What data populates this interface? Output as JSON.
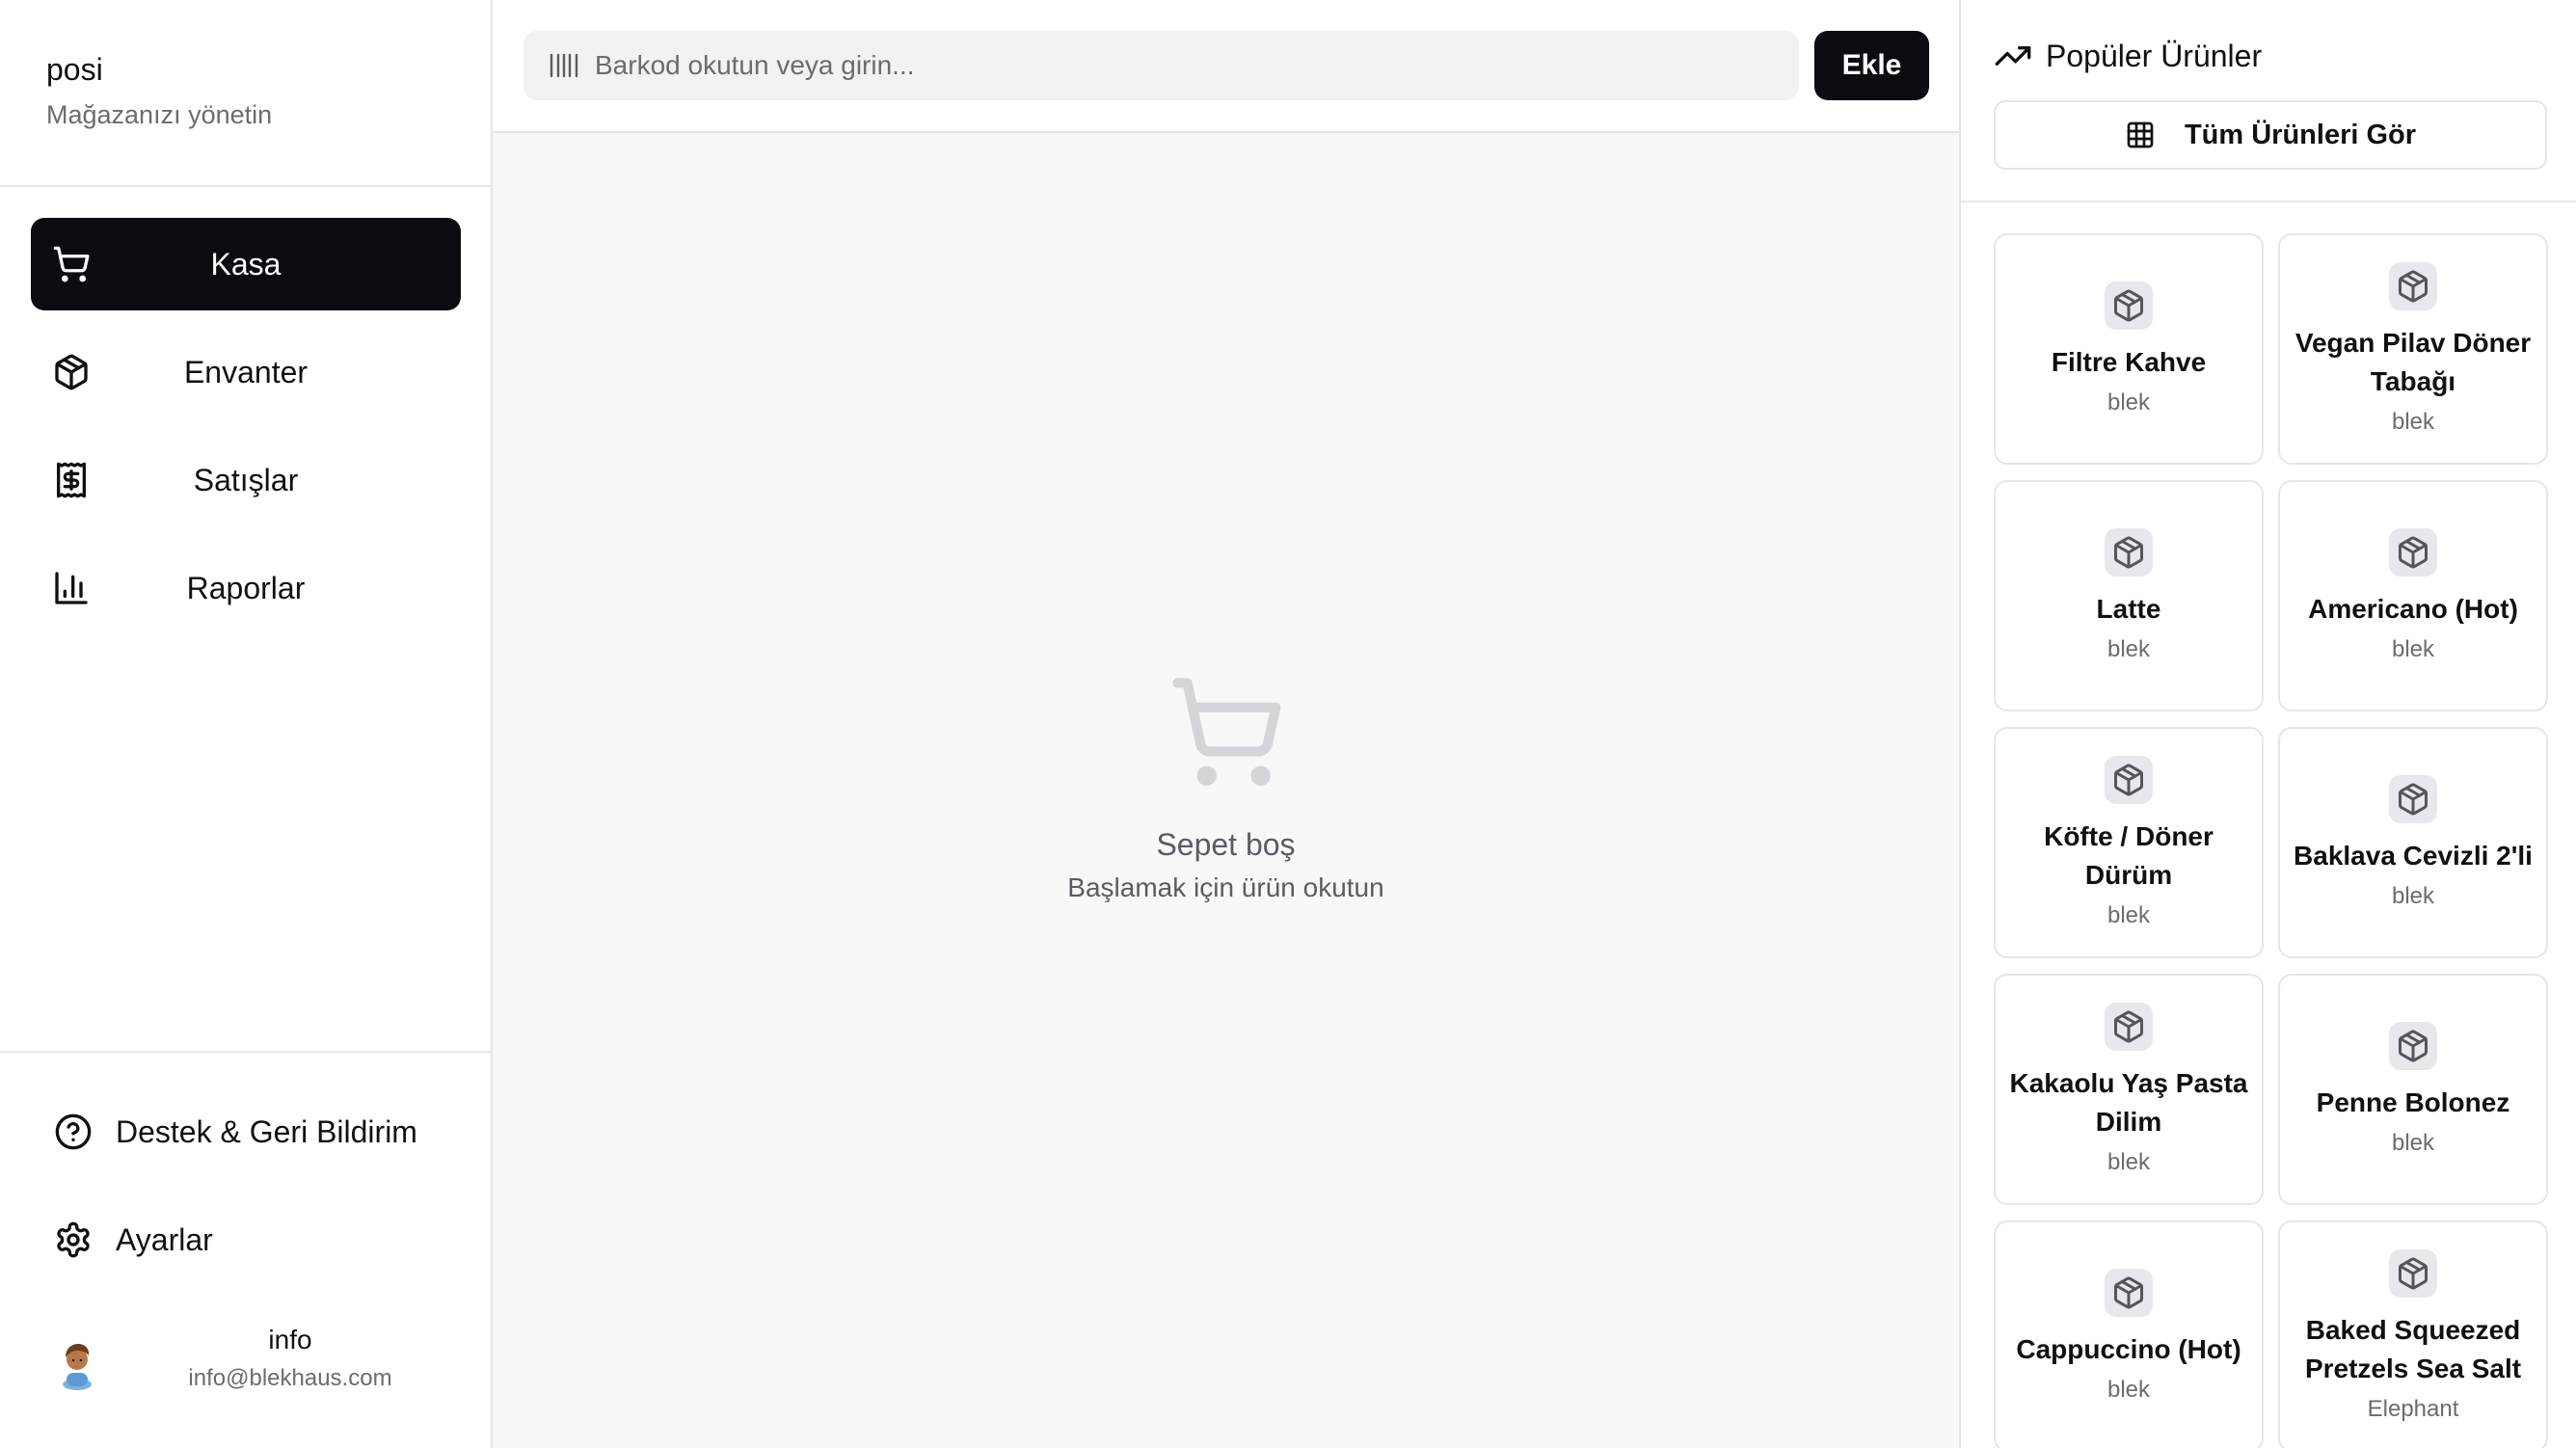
{
  "brand": {
    "name": "posi",
    "subtitle": "Mağazanızı yönetin"
  },
  "sidebar": {
    "items": [
      {
        "label": "Kasa",
        "icon": "cart-icon",
        "active": true
      },
      {
        "label": "Envanter",
        "icon": "package-icon",
        "active": false
      },
      {
        "label": "Satışlar",
        "icon": "receipt-dollar-icon",
        "active": false
      },
      {
        "label": "Raporlar",
        "icon": "bar-chart-icon",
        "active": false
      }
    ],
    "footer": [
      {
        "label": "Destek & Geri Bildirim",
        "icon": "help-circle-icon"
      },
      {
        "label": "Ayarlar",
        "icon": "gear-icon"
      }
    ],
    "user": {
      "name": "info",
      "email": "info@blekhaus.com"
    }
  },
  "topbar": {
    "search_placeholder": "Barkod okutun veya girin...",
    "search_value": "",
    "add_label": "Ekle"
  },
  "cart": {
    "empty_title": "Sepet boş",
    "empty_subtitle": "Başlamak için ürün okutun"
  },
  "popular": {
    "title": "Popüler Ürünler",
    "view_all_label": "Tüm Ürünleri Gör",
    "products": [
      {
        "name": "Filtre Kahve",
        "brand": "blek"
      },
      {
        "name": "Vegan Pilav Döner Tabağı",
        "brand": "blek"
      },
      {
        "name": "Latte",
        "brand": "blek"
      },
      {
        "name": "Americano (Hot)",
        "brand": "blek"
      },
      {
        "name": "Köfte / Döner Dürüm",
        "brand": "blek"
      },
      {
        "name": "Baklava Cevizli 2'li",
        "brand": "blek"
      },
      {
        "name": "Kakaolu Yaş Pasta Dilim",
        "brand": "blek"
      },
      {
        "name": "Penne Bolonez",
        "brand": "blek"
      },
      {
        "name": "Cappuccino (Hot)",
        "brand": "blek"
      },
      {
        "name": "Baked Squeezed Pretzels Sea Salt",
        "brand": "Elephant"
      }
    ]
  },
  "colors": {
    "accent": "#0b0b12",
    "border": "#e6e6e9",
    "muted_text": "#6b6b72",
    "main_bg": "#f8f8f9"
  }
}
